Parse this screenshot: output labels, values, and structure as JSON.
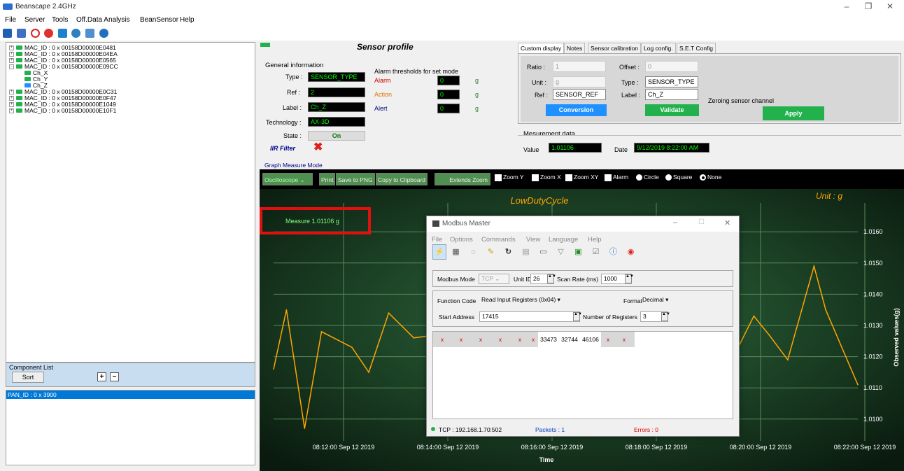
{
  "app": {
    "title": "Beanscape 2.4GHz"
  },
  "menu": [
    "File",
    "Server",
    "Tools",
    "Off.Data Analysis",
    "BeanSensor",
    "Help"
  ],
  "tree": {
    "nodes": [
      {
        "label": "MAC_ID : 0 x 00158D00000E0481",
        "expand": "+"
      },
      {
        "label": "MAC_ID : 0 x 00158D00000E04EA",
        "expand": "+"
      },
      {
        "label": "MAC_ID : 0 x 00158D00000E0565",
        "expand": "+"
      },
      {
        "label": "MAC_ID : 0 x 00158D00000E09CC",
        "expand": "-"
      },
      {
        "label": "Ch_X",
        "child": true
      },
      {
        "label": "Ch_Y",
        "child": true
      },
      {
        "label": "Ch_Z",
        "child": true,
        "selected": true
      },
      {
        "label": "MAC_ID : 0 x 00158D00000E0C31",
        "expand": "+"
      },
      {
        "label": "MAC_ID : 0 x 00158D00000E0F47",
        "expand": "+"
      },
      {
        "label": "MAC_ID : 0 x 00158D00000E1049",
        "expand": "+"
      },
      {
        "label": "MAC_ID : 0 x 00158D00000E10F1",
        "expand": "+"
      }
    ]
  },
  "component_list": {
    "title": "Component List",
    "sort": "Sort"
  },
  "pan": {
    "item": "PAN_ID : 0 x 3900"
  },
  "profile": {
    "title": "Sensor profile",
    "general": "General information",
    "type_label": "Type :",
    "type_value": "SENSOR_TYPE",
    "ref_label": "Ref :",
    "ref_value": "2",
    "label_label": "Label :",
    "label_value": "Ch_Z",
    "tech_label": "Technology :",
    "tech_value": "AX-3D",
    "state_label": "State :",
    "state_value": "On",
    "iir": "IIR Filter",
    "thresholds": "Alarm thresholds for set mode",
    "alarm": "Alarm",
    "action": "Action",
    "alert": "Alert",
    "alarm_v": "0",
    "action_v": "0",
    "alert_v": "0",
    "unit": "g"
  },
  "tabs": [
    "Custom display",
    "Notes",
    "Sensor calibration",
    "Log config.",
    "S.E.T Config"
  ],
  "custom": {
    "ratio_label": "Ratio :",
    "ratio": "1",
    "offset_label": "Offset :",
    "offset": "0",
    "unit_label": "Unit :",
    "unit": "g",
    "type_label": "Type :",
    "type": "SENSOR_TYPE",
    "ref_label": "Ref :",
    "ref": "SENSOR_REF",
    "label_label": "Label :",
    "label": "Ch_Z",
    "conversion": "Conversion",
    "validate": "Validate",
    "zeroing": "Zeroing sensor channel",
    "apply": "Apply"
  },
  "measurement": {
    "title": "Mesurement data",
    "value_label": "Value",
    "value": "1.01106",
    "date_label": "Date",
    "date": "9/12/2019 8:22:00 AM"
  },
  "graph": {
    "mode_title": "Graph Measure Mode",
    "mode": "Oscilloscope",
    "print": "Print",
    "save": "Save to PNG",
    "copy": "Copy to Clipboard",
    "extends": "Extends Zoom",
    "zoomy": "Zoom Y",
    "zoomx": "Zoom X",
    "zoomxy": "Zoom XY",
    "alarm": "Alarm",
    "circle": "Circle",
    "square": "Square",
    "none": "None"
  },
  "chart_data": {
    "type": "line",
    "title": "LowDutyCycle",
    "unit": "Unit : g",
    "measure": "Measure 1.01106 g",
    "xlabel": "Time",
    "ylabel": "Observed values(g)",
    "yticks": [
      "1.0160",
      "1.0150",
      "1.0140",
      "1.0130",
      "1.0120",
      "1.0110",
      "1.0100"
    ],
    "xticks": [
      "08:12:00 Sep 12 2019",
      "08:14:00 Sep 12 2019",
      "08:16:00 Sep 12 2019",
      "08:18:00 Sep 12 2019",
      "08:20:00 Sep 12 2019",
      "08:22:00 Sep 12 2019"
    ],
    "ylim": [
      1.0093,
      1.0167
    ],
    "series": [
      {
        "values": [
          1.0116,
          1.0135,
          1.0097,
          1.0128,
          1.0123,
          1.0115,
          1.0134,
          1.0126,
          1.0127,
          1.0129,
          1.0128,
          1.0132,
          1.0146,
          1.0134,
          1.0142,
          1.0121,
          1.0133,
          1.0127,
          1.0119,
          1.0149,
          1.0135,
          1.0111
        ]
      }
    ],
    "x_positions": [
      0,
      0.022,
      0.053,
      0.082,
      0.134,
      0.163,
      0.197,
      0.24,
      0.28,
      0.33,
      0.4,
      0.48,
      0.56,
      0.64,
      0.755,
      0.79,
      0.822,
      0.848,
      0.88,
      0.925,
      0.945,
      1.0
    ]
  },
  "modbus": {
    "title": "Modbus Master",
    "menu": [
      "File",
      "Options",
      "Commands",
      "View",
      "Language",
      "Help"
    ],
    "mode_label": "Modbus Mode",
    "mode": "TCP",
    "unit_label": "Unit ID",
    "unit": "26",
    "scan_label": "Scan Rate (ms)",
    "scan": "1000",
    "func_label": "Function Code",
    "func": "Read Input Registers (0x04)",
    "format_label": "Format",
    "format": "Decimal",
    "start_label": "Start Address",
    "start": "17415",
    "num_label": "Number of Registers",
    "num": "3",
    "registers": [
      "x",
      "x",
      "x",
      "x",
      "x",
      "x",
      "33473",
      "32744",
      "46106",
      "x",
      "x"
    ],
    "status_conn": "TCP : 192.168.1.70:502",
    "status_packets": "Packets : 1",
    "status_errors": "Errors : 0"
  }
}
